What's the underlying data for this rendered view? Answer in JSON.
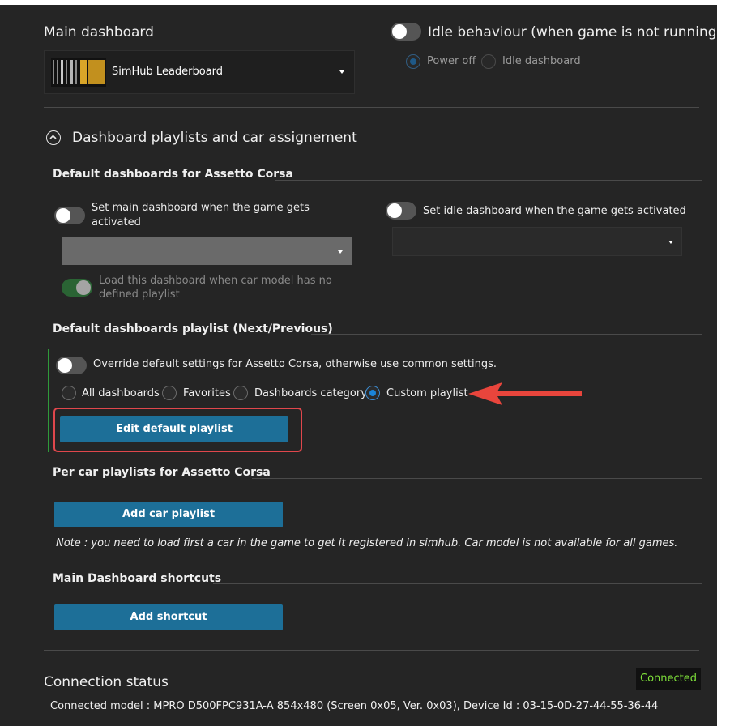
{
  "main_dashboard": {
    "title": "Main dashboard",
    "selected": "SimHub Leaderboard"
  },
  "idle": {
    "title": "Idle behaviour (when game is not running",
    "options": [
      "Power off",
      "Idle dashboard"
    ]
  },
  "playlists": {
    "title": "Dashboard playlists and car assignement"
  },
  "defaults": {
    "title": "Default dashboards for Assetto Corsa",
    "set_main_line1": "Set main dashboard when the game gets",
    "set_main_line2": "activated",
    "set_idle": "Set idle dashboard when the game gets activated",
    "load_line1": "Load this dashboard when car model has no",
    "load_line2": "defined playlist"
  },
  "playlist_section": {
    "title": "Default dashboards playlist (Next/Previous)",
    "override": "Override default settings for Assetto Corsa, otherwise use common settings.",
    "options": [
      "All dashboards",
      "Favorites",
      "Dashboards category",
      "Custom playlist"
    ],
    "edit_button": "Edit default playlist"
  },
  "per_car": {
    "title": "Per car playlists for Assetto Corsa",
    "add_button": "Add car playlist",
    "note": "Note : you need to load first a car in the game to get it registered in simhub. Car model is not available for all games."
  },
  "shortcuts": {
    "title": "Main Dashboard shortcuts",
    "add_button": "Add shortcut"
  },
  "connection": {
    "title": "Connection status",
    "status": "Connected",
    "model": "Connected model : MPRO D500FPC931A-A 854x480 (Screen 0x05, Ver. 0x03), Device Id : 03-15-0D-27-44-55-36-44"
  },
  "colors": {
    "background": "#252525",
    "accent_button": "#1d6f98",
    "connected_text": "#7ee03a",
    "highlight_box": "#e0474c",
    "arrow": "#e8453c"
  }
}
